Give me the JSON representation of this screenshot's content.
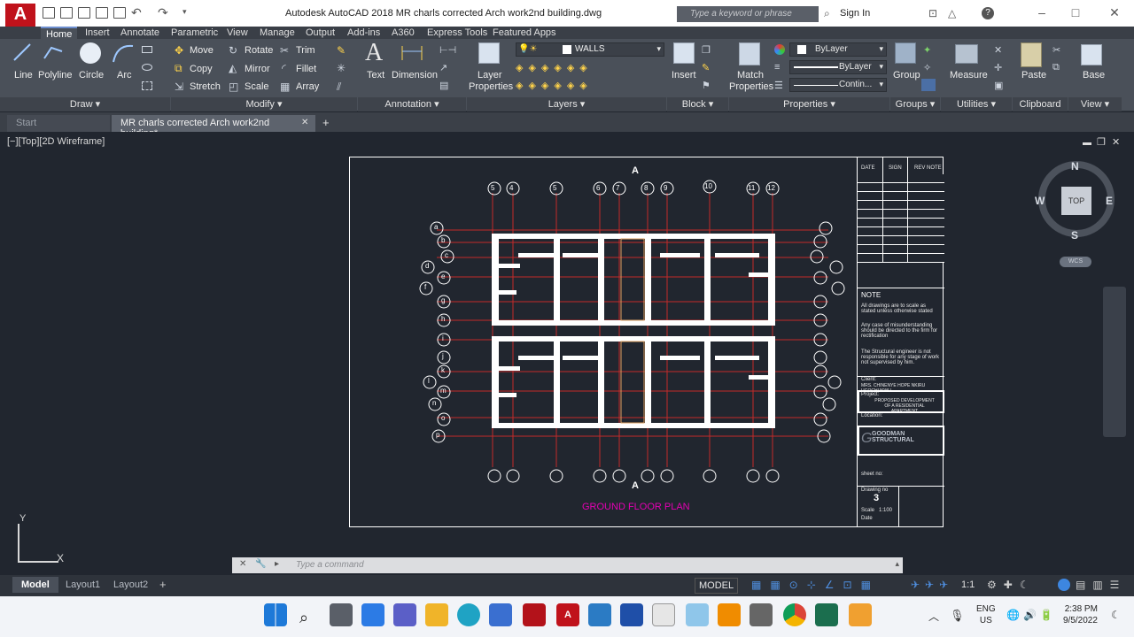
{
  "window": {
    "app_logo": "A",
    "title": "Autodesk AutoCAD 2018    MR charls corrected Arch work2nd building.dwg",
    "search_placeholder": "Type a keyword or phrase",
    "sign_in": "Sign In"
  },
  "ribbon_tabs": [
    "Home",
    "Insert",
    "Annotate",
    "Parametric",
    "View",
    "Manage",
    "Output",
    "Add-ins",
    "A360",
    "Express Tools",
    "Featured Apps"
  ],
  "ribbon": {
    "draw": {
      "title": "Draw",
      "line": "Line",
      "polyline": "Polyline",
      "circle": "Circle",
      "arc": "Arc"
    },
    "modify": {
      "title": "Modify",
      "move": "Move",
      "rotate": "Rotate",
      "trim": "Trim",
      "copy": "Copy",
      "mirror": "Mirror",
      "fillet": "Fillet",
      "stretch": "Stretch",
      "scale": "Scale",
      "array": "Array"
    },
    "annotation": {
      "title": "Annotation",
      "text": "Text",
      "dimension": "Dimension"
    },
    "layers": {
      "title": "Layers",
      "layer_properties_1": "Layer",
      "layer_properties_2": "Properties",
      "current_layer": "WALLS"
    },
    "block": {
      "title": "Block",
      "insert": "Insert"
    },
    "properties": {
      "title": "Properties",
      "match_1": "Match",
      "match_2": "Properties",
      "color": "ByLayer",
      "lineweight": "ByLayer",
      "linetype": "Contin..."
    },
    "groups": {
      "title": "Groups",
      "group": "Group"
    },
    "utilities": {
      "title": "Utilities",
      "measure": "Measure"
    },
    "clipboard": {
      "title": "Clipboard",
      "paste": "Paste"
    },
    "view": {
      "title": "View",
      "base": "Base"
    }
  },
  "doc_tabs": {
    "start": "Start",
    "drawing": "MR charls corrected Arch work2nd building*"
  },
  "viewport": {
    "label": "[−][Top][2D Wireframe]",
    "compass": {
      "n": "N",
      "s": "S",
      "e": "E",
      "w": "W",
      "top": "TOP",
      "wcs": "WCS"
    },
    "ucs": {
      "y": "Y",
      "x": "X"
    }
  },
  "drawing": {
    "grid_top": [
      "5",
      "4",
      "5",
      "6",
      "7",
      "8",
      "9",
      "10",
      "11",
      "12"
    ],
    "grid_left": [
      "a",
      "b",
      "c",
      "d",
      "e",
      "f",
      "g",
      "h",
      "i",
      "j",
      "k",
      "l",
      "m",
      "n",
      "o",
      "p"
    ],
    "section_mark": "A",
    "caption": "GROUND FLOOR PLAN",
    "title_block": {
      "revision_headers": [
        "DATE",
        "SIGN",
        "REV NOTE"
      ],
      "note_title": "NOTE",
      "note_1": "All drawings are to scale as stated unless otherwise stated",
      "note_2": "Any case of misunderstanding should be directed to the firm for rectification",
      "note_3": "The Structural engineer is not responsible for any stage of work not supervised by him.",
      "client_label": "Client:",
      "client": "MRS. CHINENYE HOPE NKIRU UGOCHUKWU",
      "project_label": "Project:",
      "project": "PROPOSED DEVELOPMENT OF A RESIDENTIAL APARTMENT",
      "location_label": "Location:",
      "firm": "GOODMAN STRUCTURAL",
      "sheet_label": "sheet no:",
      "drawing_no_label": "Drawing no",
      "drawing_no": "3",
      "scale_label": "Scale",
      "scale": "1:100",
      "date_label": "Date"
    }
  },
  "command_line": {
    "placeholder": "Type a command"
  },
  "layout_tabs": [
    "Model",
    "Layout1",
    "Layout2"
  ],
  "status": {
    "model": "MODEL",
    "scale": "1:1"
  },
  "taskbar": {
    "lang_1": "ENG",
    "lang_2": "US",
    "time": "2:38 PM",
    "date": "9/5/2022"
  }
}
